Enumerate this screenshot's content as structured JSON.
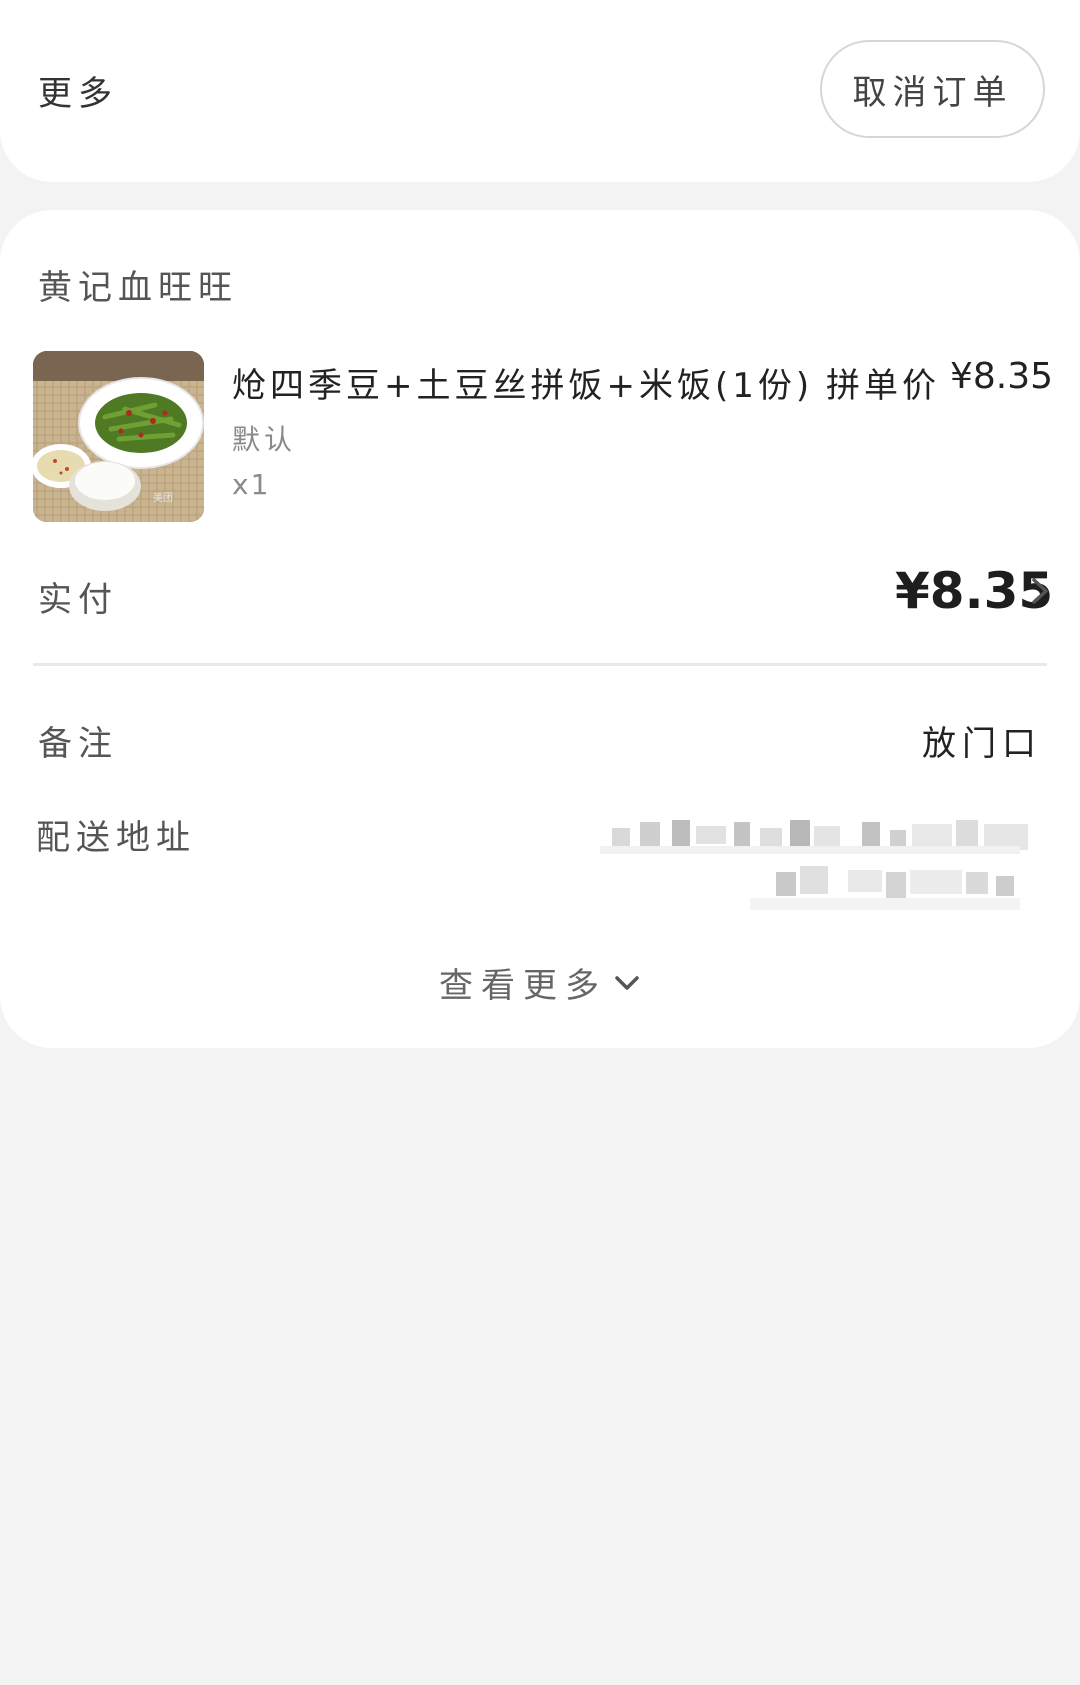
{
  "top_card": {
    "more_label": "更多",
    "cancel_button_label": "取消订单"
  },
  "order": {
    "shop_name": "黄记血旺旺",
    "item": {
      "name": "炝四季豆+土豆丝拼饭+米饭(1份)",
      "price_label": "拼单价",
      "price": "¥8.35",
      "spec": "默认",
      "quantity": "x1",
      "thumbnail_icon": "food-photo"
    },
    "paid_label": "实付",
    "paid_amount": "¥8.35",
    "note_label": "备注",
    "note_value": "放门口",
    "address_label": "配送地址",
    "view_more_label": "查看更多"
  },
  "colors": {
    "background": "#f3f3f3",
    "card": "#ffffff",
    "text_primary": "#222222",
    "text_secondary": "#555555",
    "text_muted": "#8a8a8a",
    "divider": "#e9e9e9"
  }
}
